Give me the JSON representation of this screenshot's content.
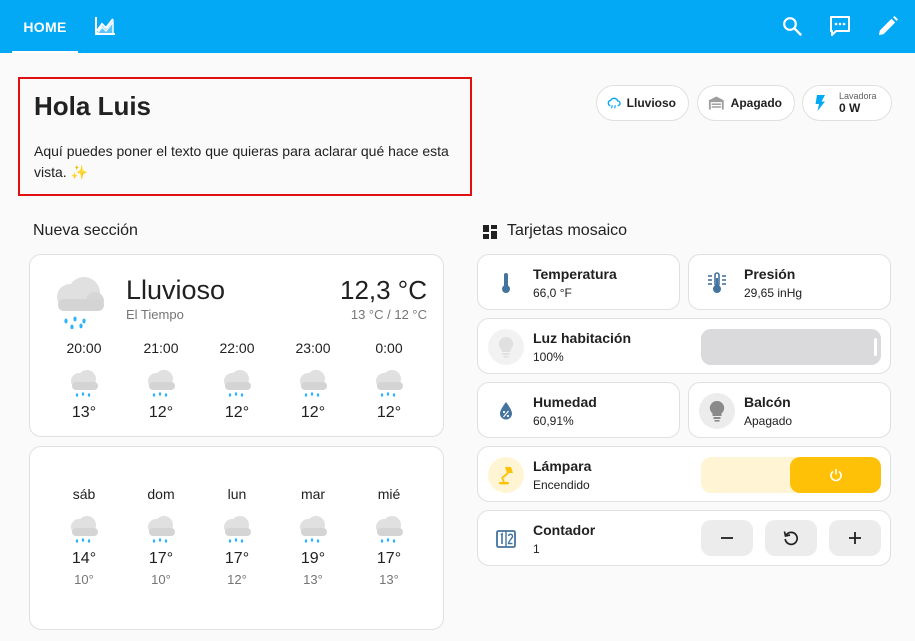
{
  "header": {
    "tabs": [
      {
        "label": "HOME",
        "active": true
      },
      {
        "icon": "energy-chart-icon"
      }
    ],
    "actions": [
      "search-icon",
      "assist-chat-icon",
      "edit-pencil-icon"
    ],
    "colors": {
      "background": "#03a9f4",
      "foreground": "#ffffff"
    }
  },
  "markdown": {
    "title": "Hola Luis",
    "text": "Aquí puedes poner el texto que quieras para aclarar qué hace esta vista. ✨",
    "border_color": "#e10f0f"
  },
  "badges": [
    {
      "icon": "cloud-rain-icon",
      "label": "Lluvioso"
    },
    {
      "icon": "garage-icon",
      "label": "Apagado"
    },
    {
      "icon": "flash-icon",
      "name": "Lavadora",
      "value": "0 W"
    }
  ],
  "sections": {
    "left_title": "Nueva sección",
    "right_title": "Tarjetas mosaico"
  },
  "weather": {
    "state": "Lluvioso",
    "name": "El Tiempo",
    "temperature": "12,3 °C",
    "range": "13 °C / 12 °C",
    "hourly": [
      {
        "time": "20:00",
        "temp": "13°"
      },
      {
        "time": "21:00",
        "temp": "12°"
      },
      {
        "time": "22:00",
        "temp": "12°"
      },
      {
        "time": "23:00",
        "temp": "12°"
      },
      {
        "time": "0:00",
        "temp": "12°"
      }
    ],
    "daily": [
      {
        "day": "sáb",
        "high": "14°",
        "low": "10°"
      },
      {
        "day": "dom",
        "high": "17°",
        "low": "10°"
      },
      {
        "day": "lun",
        "high": "17°",
        "low": "12°"
      },
      {
        "day": "mar",
        "high": "19°",
        "low": "13°"
      },
      {
        "day": "mié",
        "high": "17°",
        "low": "13°"
      }
    ]
  },
  "tiles": {
    "temperatura": {
      "name": "Temperatura",
      "state": "66,0 °F",
      "icon": "thermometer-icon"
    },
    "presion": {
      "name": "Presión",
      "state": "29,65 inHg",
      "icon": "gauge-thermometer-icon"
    },
    "luz": {
      "name": "Luz habitación",
      "state": "100%",
      "icon": "lightbulb-icon",
      "level_percent": 100
    },
    "humedad": {
      "name": "Humedad",
      "state": "60,91%",
      "icon": "water-percent-icon"
    },
    "balcon": {
      "name": "Balcón",
      "state": "Apagado",
      "icon": "lightbulb-icon"
    },
    "lampara": {
      "name": "Lámpara",
      "state": "Encendido",
      "icon": "desk-lamp-icon",
      "on": true,
      "accent": "#ffc107"
    },
    "contador": {
      "name": "Contador",
      "state": "1",
      "icon": "counter-icon"
    }
  },
  "colors": {
    "accent": "#03a9f4",
    "tile_blue": "#44739e",
    "lamp_on": "#ffc107"
  }
}
